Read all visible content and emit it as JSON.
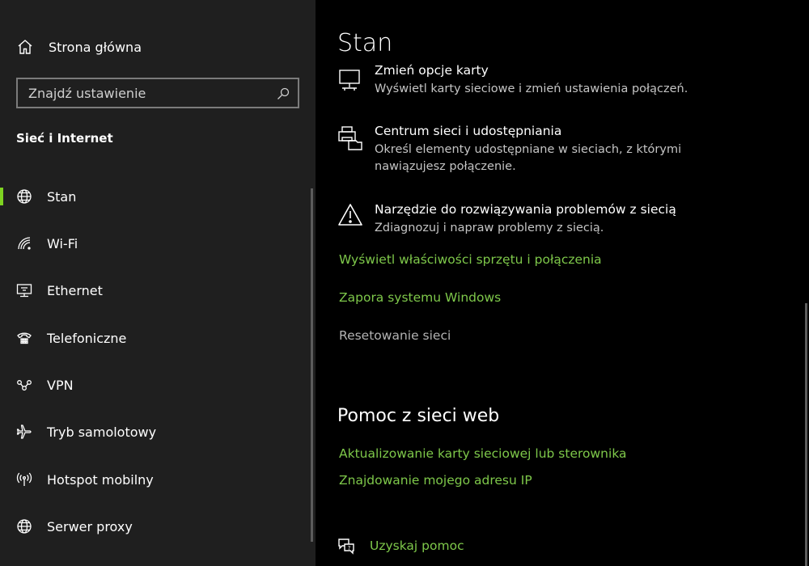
{
  "colors": {
    "accent": "#7ed321",
    "link": "#7ec84a",
    "sidebar_bg": "#1f1f1f",
    "main_bg": "#000000"
  },
  "sidebar": {
    "home_label": "Strona główna",
    "home_icon": "home-icon",
    "search_placeholder": "Znajdź ustawienie",
    "search_icon": "search-icon",
    "section_title": "Sieć i Internet",
    "items": [
      {
        "label": "Stan",
        "icon": "globe-status-icon",
        "active": true
      },
      {
        "label": "Wi-Fi",
        "icon": "wifi-icon"
      },
      {
        "label": "Ethernet",
        "icon": "ethernet-icon"
      },
      {
        "label": "Telefoniczne",
        "icon": "dialup-icon"
      },
      {
        "label": "VPN",
        "icon": "vpn-icon"
      },
      {
        "label": "Tryb samolotowy",
        "icon": "airplane-icon"
      },
      {
        "label": "Hotspot mobilny",
        "icon": "hotspot-icon"
      },
      {
        "label": "Serwer proxy",
        "icon": "globe-icon"
      }
    ]
  },
  "main": {
    "title": "Stan",
    "options": [
      {
        "title": "Zmień opcje karty",
        "desc": "Wyświetl karty sieciowe i zmień ustawienia połączeń.",
        "icon": "monitor-network-icon"
      },
      {
        "title": "Centrum sieci i udostępniania",
        "desc": "Określ elementy udostępniane w sieciach, z którymi nawiązujesz połączenie.",
        "icon": "sharing-printer-icon"
      },
      {
        "title": "Narzędzie do rozwiązywania problemów z siecią",
        "desc": "Zdiagnozuj i napraw problemy z siecią.",
        "icon": "warning-icon"
      }
    ],
    "links": [
      "Wyświetl właściwości sprzętu i połączenia",
      "Zapora systemu Windows",
      "Resetowanie sieci"
    ],
    "help_title": "Pomoc z sieci web",
    "help_links": [
      "Aktualizowanie karty sieciowej lub sterownika",
      "Znajdowanie mojego adresu IP"
    ],
    "get_help_label": "Uzyskaj pomoc",
    "get_help_icon": "help-chat-icon"
  }
}
